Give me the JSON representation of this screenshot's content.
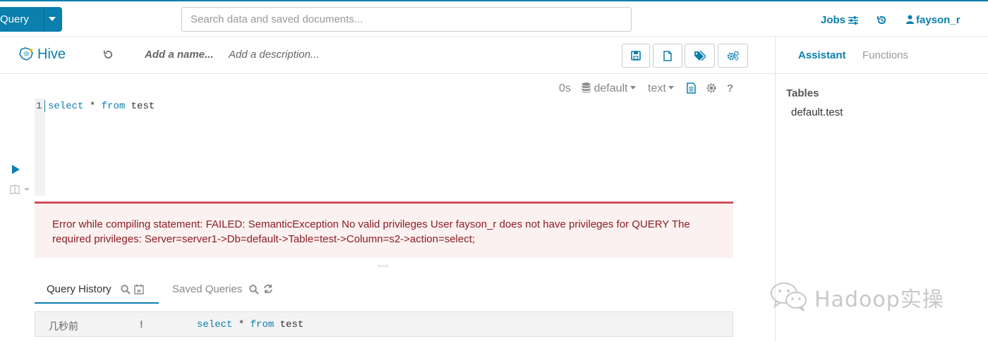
{
  "topbar": {
    "query_label": "Query",
    "search_placeholder": "Search data and saved documents...",
    "jobs_label": "Jobs",
    "user_label": "fayson_r"
  },
  "editor": {
    "app_title": "Hive",
    "name_placeholder": "Add a name...",
    "description_placeholder": "Add a description...",
    "elapsed": "0s",
    "database": "default",
    "format": "text",
    "help_label": "?",
    "line_number": "1",
    "code": {
      "kw1": "select",
      "mid": " * ",
      "kw2": "from",
      "table": " test"
    }
  },
  "error": {
    "line1": "Error while compiling statement: FAILED: SemanticException No valid privileges User fayson_r does not have privileges for QUERY The",
    "line2": "required privileges: Server=server1->Db=default->Table=test->Column=s2->action=select;"
  },
  "bottom_tabs": {
    "history": "Query History",
    "saved": "Saved Queries"
  },
  "history_rows": [
    {
      "time": "几秒前",
      "status": "!",
      "kw1": "select",
      "mid": " * ",
      "kw2": "from",
      "table": " test"
    }
  ],
  "assistant": {
    "tab_assistant": "Assistant",
    "tab_functions": "Functions",
    "tables_heading": "Tables",
    "tables": [
      "default.test"
    ]
  },
  "watermark": "Hadoop实操",
  "colors": {
    "accent": "#0B7FAD",
    "error_text": "#8c1d24",
    "error_bg": "#fbf1f1",
    "error_border": "#d04e5a"
  },
  "icons": {
    "jobs": "sliders-icon",
    "history": "history-icon",
    "user": "user-icon",
    "save": "save-icon",
    "new": "file-icon",
    "tags": "tags-icon",
    "settings": "cogs-icon",
    "run": "play-icon",
    "snippet": "book-icon"
  }
}
